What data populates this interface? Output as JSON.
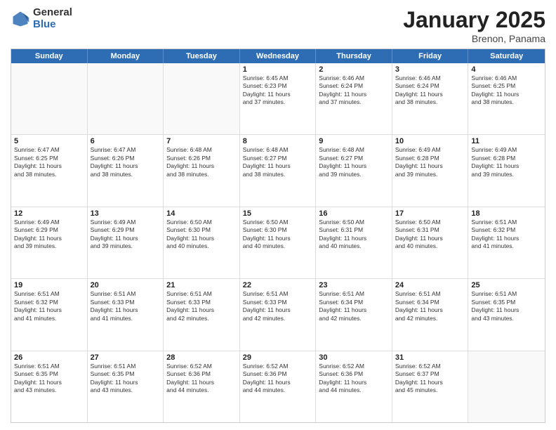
{
  "header": {
    "logo_general": "General",
    "logo_blue": "Blue",
    "title": "January 2025",
    "location": "Brenon, Panama"
  },
  "weekdays": [
    "Sunday",
    "Monday",
    "Tuesday",
    "Wednesday",
    "Thursday",
    "Friday",
    "Saturday"
  ],
  "rows": [
    [
      {
        "day": "",
        "info": "",
        "empty": true
      },
      {
        "day": "",
        "info": "",
        "empty": true
      },
      {
        "day": "",
        "info": "",
        "empty": true
      },
      {
        "day": "1",
        "info": "Sunrise: 6:45 AM\nSunset: 6:23 PM\nDaylight: 11 hours\nand 37 minutes."
      },
      {
        "day": "2",
        "info": "Sunrise: 6:46 AM\nSunset: 6:24 PM\nDaylight: 11 hours\nand 37 minutes."
      },
      {
        "day": "3",
        "info": "Sunrise: 6:46 AM\nSunset: 6:24 PM\nDaylight: 11 hours\nand 38 minutes."
      },
      {
        "day": "4",
        "info": "Sunrise: 6:46 AM\nSunset: 6:25 PM\nDaylight: 11 hours\nand 38 minutes."
      }
    ],
    [
      {
        "day": "5",
        "info": "Sunrise: 6:47 AM\nSunset: 6:25 PM\nDaylight: 11 hours\nand 38 minutes."
      },
      {
        "day": "6",
        "info": "Sunrise: 6:47 AM\nSunset: 6:26 PM\nDaylight: 11 hours\nand 38 minutes."
      },
      {
        "day": "7",
        "info": "Sunrise: 6:48 AM\nSunset: 6:26 PM\nDaylight: 11 hours\nand 38 minutes."
      },
      {
        "day": "8",
        "info": "Sunrise: 6:48 AM\nSunset: 6:27 PM\nDaylight: 11 hours\nand 38 minutes."
      },
      {
        "day": "9",
        "info": "Sunrise: 6:48 AM\nSunset: 6:27 PM\nDaylight: 11 hours\nand 39 minutes."
      },
      {
        "day": "10",
        "info": "Sunrise: 6:49 AM\nSunset: 6:28 PM\nDaylight: 11 hours\nand 39 minutes."
      },
      {
        "day": "11",
        "info": "Sunrise: 6:49 AM\nSunset: 6:28 PM\nDaylight: 11 hours\nand 39 minutes."
      }
    ],
    [
      {
        "day": "12",
        "info": "Sunrise: 6:49 AM\nSunset: 6:29 PM\nDaylight: 11 hours\nand 39 minutes."
      },
      {
        "day": "13",
        "info": "Sunrise: 6:49 AM\nSunset: 6:29 PM\nDaylight: 11 hours\nand 39 minutes."
      },
      {
        "day": "14",
        "info": "Sunrise: 6:50 AM\nSunset: 6:30 PM\nDaylight: 11 hours\nand 40 minutes."
      },
      {
        "day": "15",
        "info": "Sunrise: 6:50 AM\nSunset: 6:30 PM\nDaylight: 11 hours\nand 40 minutes."
      },
      {
        "day": "16",
        "info": "Sunrise: 6:50 AM\nSunset: 6:31 PM\nDaylight: 11 hours\nand 40 minutes."
      },
      {
        "day": "17",
        "info": "Sunrise: 6:50 AM\nSunset: 6:31 PM\nDaylight: 11 hours\nand 40 minutes."
      },
      {
        "day": "18",
        "info": "Sunrise: 6:51 AM\nSunset: 6:32 PM\nDaylight: 11 hours\nand 41 minutes."
      }
    ],
    [
      {
        "day": "19",
        "info": "Sunrise: 6:51 AM\nSunset: 6:32 PM\nDaylight: 11 hours\nand 41 minutes."
      },
      {
        "day": "20",
        "info": "Sunrise: 6:51 AM\nSunset: 6:33 PM\nDaylight: 11 hours\nand 41 minutes."
      },
      {
        "day": "21",
        "info": "Sunrise: 6:51 AM\nSunset: 6:33 PM\nDaylight: 11 hours\nand 42 minutes."
      },
      {
        "day": "22",
        "info": "Sunrise: 6:51 AM\nSunset: 6:33 PM\nDaylight: 11 hours\nand 42 minutes."
      },
      {
        "day": "23",
        "info": "Sunrise: 6:51 AM\nSunset: 6:34 PM\nDaylight: 11 hours\nand 42 minutes."
      },
      {
        "day": "24",
        "info": "Sunrise: 6:51 AM\nSunset: 6:34 PM\nDaylight: 11 hours\nand 42 minutes."
      },
      {
        "day": "25",
        "info": "Sunrise: 6:51 AM\nSunset: 6:35 PM\nDaylight: 11 hours\nand 43 minutes."
      }
    ],
    [
      {
        "day": "26",
        "info": "Sunrise: 6:51 AM\nSunset: 6:35 PM\nDaylight: 11 hours\nand 43 minutes."
      },
      {
        "day": "27",
        "info": "Sunrise: 6:51 AM\nSunset: 6:35 PM\nDaylight: 11 hours\nand 43 minutes."
      },
      {
        "day": "28",
        "info": "Sunrise: 6:52 AM\nSunset: 6:36 PM\nDaylight: 11 hours\nand 44 minutes."
      },
      {
        "day": "29",
        "info": "Sunrise: 6:52 AM\nSunset: 6:36 PM\nDaylight: 11 hours\nand 44 minutes."
      },
      {
        "day": "30",
        "info": "Sunrise: 6:52 AM\nSunset: 6:36 PM\nDaylight: 11 hours\nand 44 minutes."
      },
      {
        "day": "31",
        "info": "Sunrise: 6:52 AM\nSunset: 6:37 PM\nDaylight: 11 hours\nand 45 minutes."
      },
      {
        "day": "",
        "info": "",
        "empty": true
      }
    ]
  ]
}
